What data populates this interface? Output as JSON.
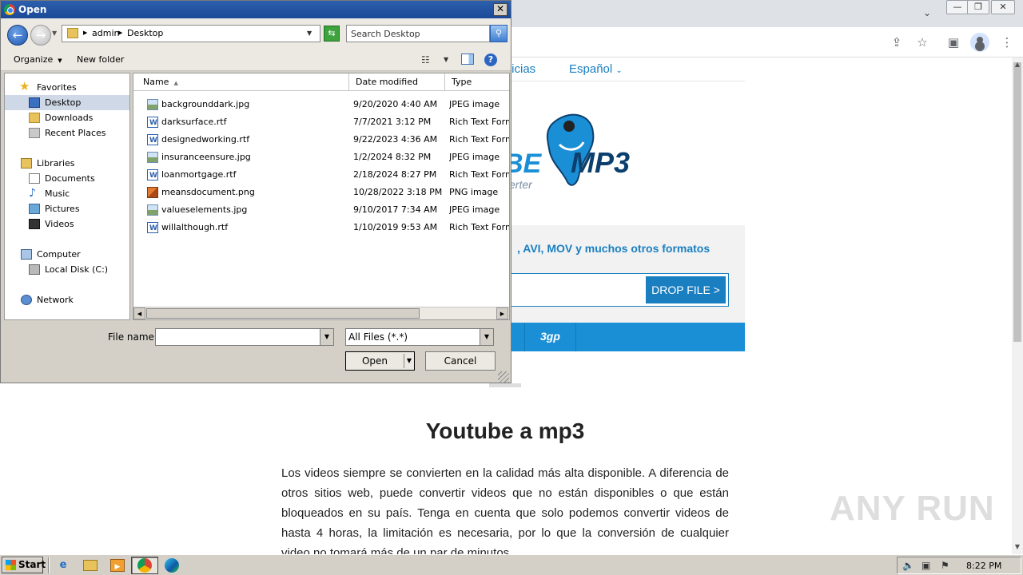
{
  "dialog": {
    "title": "Open",
    "breadcrumb": [
      "admin",
      "Desktop"
    ],
    "search_placeholder": "Search Desktop",
    "toolbar": {
      "organize": "Organize",
      "new_folder": "New folder"
    },
    "nav": {
      "favorites": "Favorites",
      "desktop": "Desktop",
      "downloads": "Downloads",
      "recent_places": "Recent Places",
      "libraries": "Libraries",
      "documents": "Documents",
      "music": "Music",
      "pictures": "Pictures",
      "videos": "Videos",
      "computer": "Computer",
      "local_disk": "Local Disk (C:)",
      "network": "Network"
    },
    "columns": {
      "name": "Name",
      "date": "Date modified",
      "type": "Type"
    },
    "files": [
      {
        "name": "backgrounddark.jpg",
        "date": "9/20/2020 4:40 AM",
        "type": "JPEG image",
        "icon": "jpg"
      },
      {
        "name": "darksurface.rtf",
        "date": "7/7/2021 3:12 PM",
        "type": "Rich Text Format",
        "icon": "rtf"
      },
      {
        "name": "designedworking.rtf",
        "date": "9/22/2023 4:36 AM",
        "type": "Rich Text Format",
        "icon": "rtf"
      },
      {
        "name": "insuranceensure.jpg",
        "date": "1/2/2024 8:32 PM",
        "type": "JPEG image",
        "icon": "jpg"
      },
      {
        "name": "loanmortgage.rtf",
        "date": "2/18/2024 8:27 PM",
        "type": "Rich Text Format",
        "icon": "rtf"
      },
      {
        "name": "meansdocument.png",
        "date": "10/28/2022 3:18 PM",
        "type": "PNG image",
        "icon": "png"
      },
      {
        "name": "valueselements.jpg",
        "date": "9/10/2017 7:34 AM",
        "type": "JPEG image",
        "icon": "jpg"
      },
      {
        "name": "willalthough.rtf",
        "date": "1/10/2019 9:53 AM",
        "type": "Rich Text Format",
        "icon": "rtf"
      }
    ],
    "file_name_label": "File name:",
    "file_name_value": "",
    "filter": "All Files (*.*)",
    "open_label": "Open",
    "cancel_label": "Cancel"
  },
  "page": {
    "nav_links": [
      "ticias",
      "Español"
    ],
    "logo_text": "BE",
    "logo_mp3": "MP3",
    "logo_sub": "verter",
    "formats_text": ", AVI, MOV y muchos otros formatos",
    "drop_button": "DROP FILE >",
    "format_item": "3gp",
    "headline": "Youtube a mp3",
    "paragraph": "Los videos siempre se convierten en la calidad más alta disponible. A diferencia de otros sitios web, puede convertir videos que no están disponibles o que están bloqueados en su país. Tenga en cuenta que solo podemos convertir videos de hasta 4 horas, la limitación es necesaria, por lo que la conversión de cualquier video no tomará más de un par de minutos.",
    "watermark": "ANY RUN"
  },
  "taskbar": {
    "start_label": "Start",
    "clock": "8:22 PM"
  },
  "colors": {
    "accent_blue": "#1a7fc1",
    "format_bar": "#1a8fd6",
    "dialog_title": "#2c5fad"
  }
}
